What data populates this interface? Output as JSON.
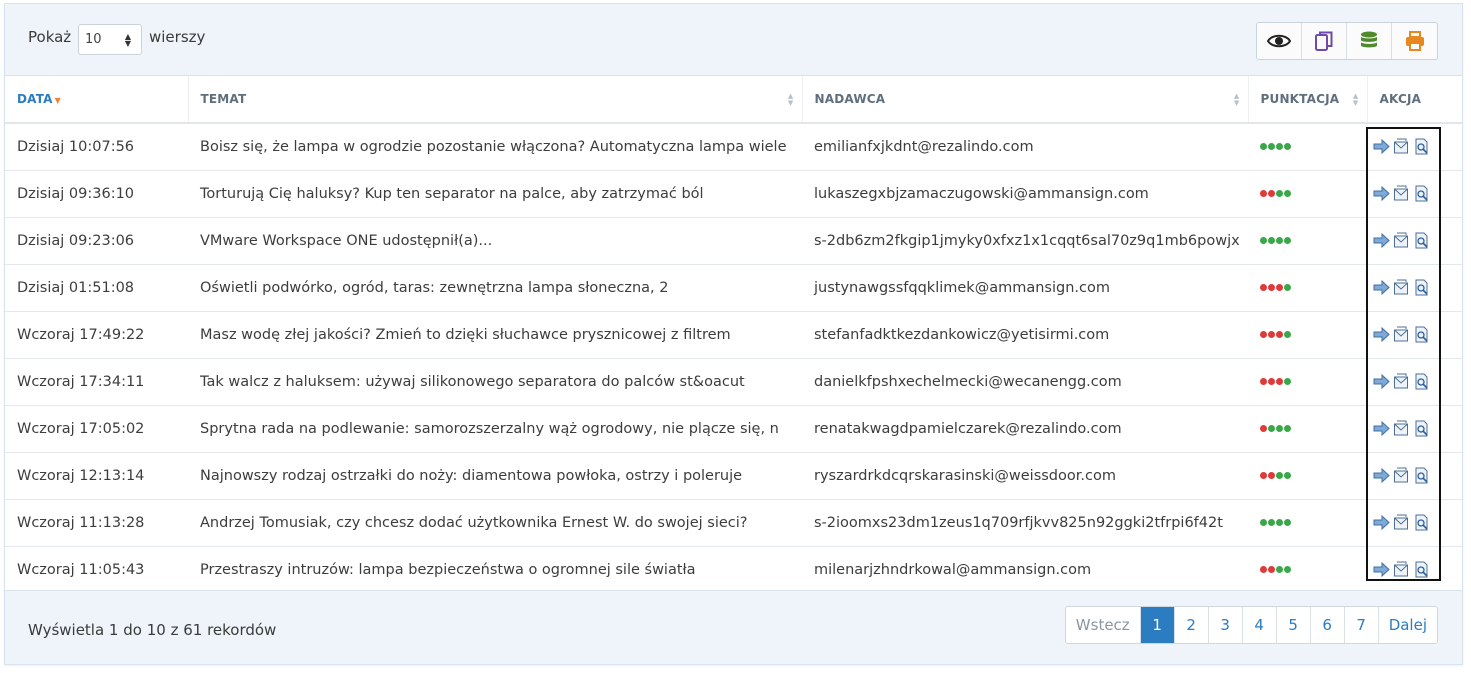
{
  "toolbar": {
    "show_label": "Pokaż",
    "rows_label": "wierszy",
    "page_length": "10",
    "tools": [
      {
        "name": "eye-icon",
        "color": "#222222"
      },
      {
        "name": "copy-icon",
        "color": "#6f4aa8"
      },
      {
        "name": "database-icon",
        "color": "#4f8a2c"
      },
      {
        "name": "print-icon",
        "color": "#e8871e"
      }
    ]
  },
  "table": {
    "headers": [
      "DATA",
      "TEMAT",
      "NADAWCA",
      "PUNKTACJA",
      "AKCJA"
    ],
    "rows": [
      {
        "date": "Dzisiaj 10:07:56",
        "subject": "Boisz się, że lampa w ogrodzie pozostanie włączona? Automatyczna lampa wiele",
        "sender": "emilianfxjkdnt@rezalindo.com",
        "score": [
          "g",
          "g",
          "g",
          "g"
        ]
      },
      {
        "date": "Dzisiaj 09:36:10",
        "subject": "Torturują Cię haluksy? Kup ten separator na palce, aby zatrzymać ból",
        "sender": "lukaszegxbjzamaczugowski@ammansign.com",
        "score": [
          "r",
          "r",
          "g",
          "g"
        ]
      },
      {
        "date": "Dzisiaj 09:23:06",
        "subject": "VMware Workspace ONE udostępnił(a)...",
        "sender": "s-2db6zm2fkgip1jmyky0xfxz1x1cqqt6sal70z9q1mb6powjx",
        "score": [
          "g",
          "g",
          "g",
          "g"
        ]
      },
      {
        "date": "Dzisiaj 01:51:08",
        "subject": "Oświetli podwórko, ogród, taras: zewnętrzna lampa słoneczna, 2",
        "sender": "justynawgssfqqklimek@ammansign.com",
        "score": [
          "r",
          "r",
          "r",
          "g"
        ]
      },
      {
        "date": "Wczoraj 17:49:22",
        "subject": "Masz wodę złej jakości? Zmień to dzięki słuchawce prysznicowej z filtrem",
        "sender": "stefanfadktkezdankowicz@yetisirmi.com",
        "score": [
          "r",
          "r",
          "r",
          "g"
        ]
      },
      {
        "date": "Wczoraj 17:34:11",
        "subject": "Tak walcz z haluksem: używaj silikonowego separatora do palców st&oacut",
        "sender": "danielkfpshxechelmecki@wecanengg.com",
        "score": [
          "r",
          "r",
          "r",
          "g"
        ]
      },
      {
        "date": "Wczoraj 17:05:02",
        "subject": "Sprytna rada na podlewanie: samorozszerzalny wąż ogrodowy, nie plącze się, n",
        "sender": "renatakwagdpamielczarek@rezalindo.com",
        "score": [
          "r",
          "g",
          "g",
          "g"
        ]
      },
      {
        "date": "Wczoraj 12:13:14",
        "subject": "Najnowszy rodzaj ostrzałki do noży: diamentowa powłoka, ostrzy i poleruje",
        "sender": "ryszardrkdcqrskarasinski@weissdoor.com",
        "score": [
          "r",
          "r",
          "g",
          "g"
        ]
      },
      {
        "date": "Wczoraj 11:13:28",
        "subject": "Andrzej Tomusiak, czy chcesz dodać użytkownika Ernest W. do swojej sieci?",
        "sender": "s-2ioomxs23dm1zeus1q709rfjkvv825n92ggki2tfrpi6f42t",
        "score": [
          "g",
          "g",
          "g",
          "g"
        ]
      },
      {
        "date": "Wczoraj 11:05:43",
        "subject": "Przestraszy intruzów: lampa bezpieczeństwa o ogromnej sile światła",
        "sender": "milenarjzhndrkowal@ammansign.com",
        "score": [
          "r",
          "r",
          "g",
          "g"
        ]
      }
    ]
  },
  "footer": {
    "info": "Wyświetla 1 do 10 z 61 rekordów",
    "pages": [
      "Wstecz",
      "1",
      "2",
      "3",
      "4",
      "5",
      "6",
      "7",
      "Dalej"
    ],
    "active_page": "1"
  },
  "colors": {
    "accent": "#2c7cc2",
    "score_green": "#3aa84a",
    "score_red": "#de3a3a"
  }
}
